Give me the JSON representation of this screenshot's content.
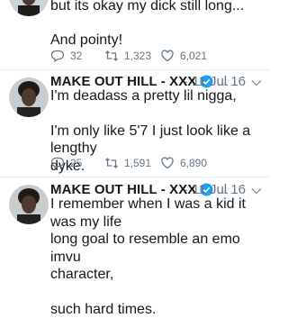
{
  "tweets": [
    {
      "text_lines": [
        "but its okay my dick still long...",
        "And pointy!"
      ],
      "replies": "32",
      "retweets": "1,323",
      "likes": "6,021"
    },
    {
      "name": "MAKE OUT HILL - XXX",
      "handle": "...",
      "date": "· 11 Jul 16",
      "text_lines": [
        "I'm deadass a pretty lil nigga,",
        "I'm only like 5'7 I just look like a lengthy",
        "dyke."
      ],
      "replies": "25",
      "retweets": "1,591",
      "likes": "6,890"
    },
    {
      "name": "MAKE OUT HILL - XXX",
      "handle": "...",
      "date": "· 11 Jul 16",
      "text_lines": [
        "I remember when I was a kid it was my life",
        "long goal to resemble an emo imvu",
        "character,",
        "such hard times."
      ]
    }
  ],
  "icons": {
    "verified_color": "#1da1f2",
    "action_color": "#657786",
    "names": [
      "reply-icon",
      "retweet-icon",
      "like-icon",
      "verified-badge-icon",
      "chevron-down-icon"
    ]
  }
}
